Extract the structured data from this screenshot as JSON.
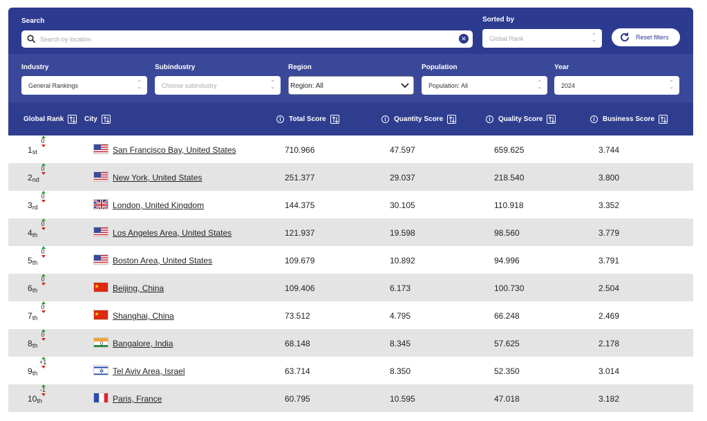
{
  "search": {
    "label": "Search",
    "placeholder": "Search by location"
  },
  "sorted": {
    "label": "Sorted by",
    "value": "Global Rank"
  },
  "reset_label": "Reset filters",
  "filters": {
    "industry": {
      "label": "Industry",
      "value": "General Rankings"
    },
    "subindustry": {
      "label": "Subindustry",
      "placeholder": "Choose subindustry"
    },
    "region": {
      "label": "Region",
      "value": "Region: All"
    },
    "population": {
      "label": "Population",
      "value": "Population: All"
    },
    "year": {
      "label": "Year",
      "value": "2024"
    }
  },
  "columns": {
    "rank": "Global Rank",
    "city": "City",
    "total": "Total Score",
    "quantity": "Quantity Score",
    "quality": "Quality Score",
    "business": "Business Score"
  },
  "colors": {
    "header_blue": "#2c3a8f",
    "up": "#1f9d3b",
    "down": "#d42020",
    "stripe": "#e4e4e4"
  },
  "rows": [
    {
      "rank": "1",
      "suffix": "st",
      "change": "0",
      "flag": "us",
      "city": "San Francisco Bay, United States",
      "total": "710.966",
      "quantity": "47.597",
      "quality": "659.625",
      "business": "3.744"
    },
    {
      "rank": "2",
      "suffix": "nd",
      "change": "0",
      "flag": "us",
      "city": "New York, United States",
      "total": "251.377",
      "quantity": "29.037",
      "quality": "218.540",
      "business": "3.800"
    },
    {
      "rank": "3",
      "suffix": "rd",
      "change": "0",
      "flag": "uk",
      "city": "London, United Kingdom",
      "total": "144.375",
      "quantity": "30.105",
      "quality": "110.918",
      "business": "3.352"
    },
    {
      "rank": "4",
      "suffix": "th",
      "change": "0",
      "flag": "us",
      "city": "Los Angeles Area, United States",
      "total": "121.937",
      "quantity": "19.598",
      "quality": "98.560",
      "business": "3.779"
    },
    {
      "rank": "5",
      "suffix": "th",
      "change": "0",
      "flag": "us",
      "city": "Boston Area, United States",
      "total": "109.679",
      "quantity": "10.892",
      "quality": "94.996",
      "business": "3.791"
    },
    {
      "rank": "6",
      "suffix": "th",
      "change": "0",
      "flag": "cn",
      "city": "Beijing, China",
      "total": "109.406",
      "quantity": "6.173",
      "quality": "100.730",
      "business": "2.504"
    },
    {
      "rank": "7",
      "suffix": "th",
      "change": "0",
      "flag": "cn",
      "city": "Shanghai, China",
      "total": "73.512",
      "quantity": "4.795",
      "quality": "66.248",
      "business": "2.469"
    },
    {
      "rank": "8",
      "suffix": "th",
      "change": "0",
      "flag": "in",
      "city": "Bangalore, India",
      "total": "68.148",
      "quantity": "8.345",
      "quality": "57.625",
      "business": "2.178"
    },
    {
      "rank": "9",
      "suffix": "th",
      "change": "+1",
      "flag": "il",
      "city": "Tel Aviv Area, Israel",
      "total": "63.714",
      "quantity": "8.350",
      "quality": "52.350",
      "business": "3.014"
    },
    {
      "rank": "10",
      "suffix": "th",
      "change": "-1",
      "flag": "fr",
      "city": "Paris, France",
      "total": "60.795",
      "quantity": "10.595",
      "quality": "47.018",
      "business": "3.182"
    }
  ]
}
